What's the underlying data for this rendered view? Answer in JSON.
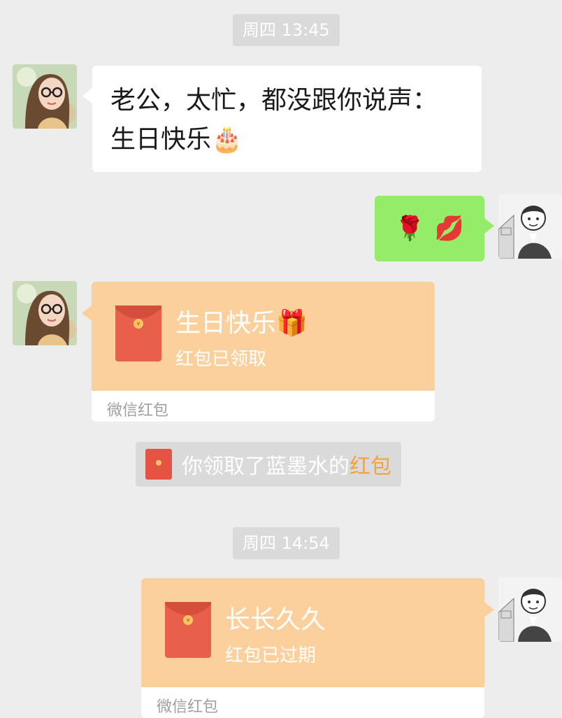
{
  "colors": {
    "background": "#ededed",
    "sent_bubble": "#95ec69",
    "received_bubble": "#ffffff",
    "red_packet": "#fcd09d",
    "envelope": "#e8604c",
    "link": "#f6a13a"
  },
  "timestamps": [
    "周四 13:45",
    "周四 14:54"
  ],
  "messages": {
    "greeting": {
      "line1": "老公，太忙，都没跟你说声：",
      "line2": "生日快乐",
      "emoji": "🎂"
    },
    "reply": {
      "emoji1": "🌹",
      "emoji2": "💋"
    },
    "packet1": {
      "title": "生日快乐",
      "emoji": "🎁",
      "status": "红包已领取",
      "footer": "微信红包"
    },
    "system_notice": {
      "text": "你领取了蓝墨水的",
      "link": "红包"
    },
    "packet2": {
      "title": "长长久久",
      "status": "红包已过期",
      "footer": "微信红包"
    }
  },
  "icons": {
    "female_avatar": "avatar-icon",
    "male_avatar": "avatar-icon",
    "red_envelope": "red-envelope-icon"
  }
}
